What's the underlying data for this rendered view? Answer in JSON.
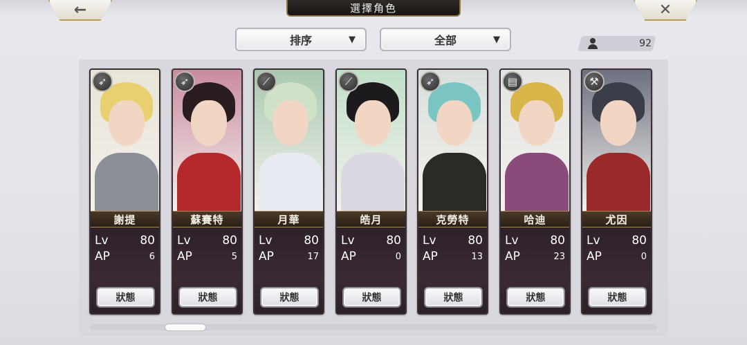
{
  "header": {
    "title": "選擇角色",
    "back_icon": "←",
    "close_icon": "✕"
  },
  "controls": {
    "sort_label": "排序",
    "filter_label": "全部",
    "arrow_glyph": "▼",
    "character_count": "92"
  },
  "characters": [
    {
      "name": "謝提",
      "lv_label": "Lv",
      "lv": "80",
      "ap_label": "AP",
      "ap": "6",
      "status_label": "狀態",
      "class_icon": "bow-icon",
      "class_glyph": "➶",
      "hair": "#e8d070",
      "body": "#8a8f98",
      "bg": "#e9e4d8"
    },
    {
      "name": "蘇賽特",
      "lv_label": "Lv",
      "lv": "80",
      "ap_label": "AP",
      "ap": "5",
      "status_label": "狀態",
      "class_icon": "bow-icon",
      "class_glyph": "➶",
      "hair": "#2a1d1f",
      "body": "#b5282c",
      "bg": "#c98aa0"
    },
    {
      "name": "月華",
      "lv_label": "Lv",
      "lv": "80",
      "ap_label": "AP",
      "ap": "17",
      "status_label": "狀態",
      "class_icon": "staff-icon",
      "class_glyph": "⟋",
      "hair": "#cfe2c8",
      "body": "#e8ecf2",
      "bg": "#a8c8b0"
    },
    {
      "name": "皓月",
      "lv_label": "Lv",
      "lv": "80",
      "ap_label": "AP",
      "ap": "0",
      "status_label": "狀態",
      "class_icon": "staff-icon",
      "class_glyph": "⟋",
      "hair": "#1c1a1c",
      "body": "#dcd8e2",
      "bg": "#bfe0c8"
    },
    {
      "name": "克勞特",
      "lv_label": "Lv",
      "lv": "80",
      "ap_label": "AP",
      "ap": "13",
      "status_label": "狀態",
      "class_icon": "bow-icon",
      "class_glyph": "➶",
      "hair": "#7bc4c4",
      "body": "#2a2a26",
      "bg": "#d8e0dc"
    },
    {
      "name": "哈迪",
      "lv_label": "Lv",
      "lv": "80",
      "ap_label": "AP",
      "ap": "23",
      "status_label": "狀態",
      "class_icon": "book-icon",
      "class_glyph": "▤",
      "hair": "#d9b64a",
      "body": "#8a4a7a",
      "bg": "#e4e4e4"
    },
    {
      "name": "尤因",
      "lv_label": "Lv",
      "lv": "80",
      "ap_label": "AP",
      "ap": "0",
      "status_label": "狀態",
      "class_icon": "hammer-icon",
      "class_glyph": "⚒",
      "hair": "#3b3e48",
      "body": "#9a2a2a",
      "bg": "#6d6f80"
    }
  ]
}
